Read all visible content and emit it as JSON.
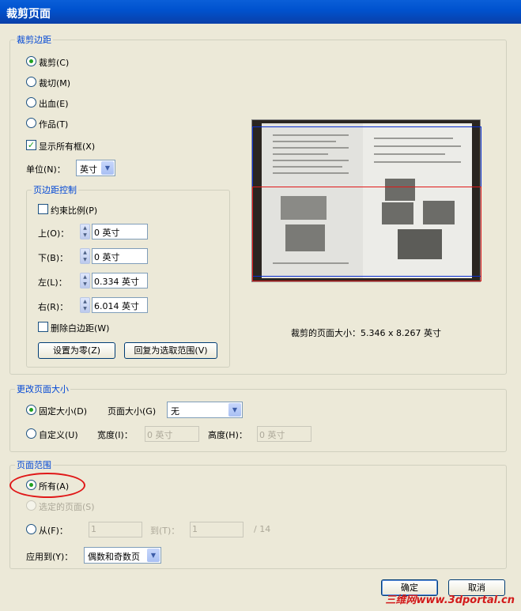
{
  "window": {
    "title": "裁剪页面"
  },
  "crop_margins": {
    "legend": "裁剪边距",
    "options": [
      {
        "label": "裁剪(C)",
        "checked": true
      },
      {
        "label": "裁切(M)",
        "checked": false
      },
      {
        "label": "出血(E)",
        "checked": false
      },
      {
        "label": "作品(T)",
        "checked": false
      }
    ],
    "show_all_boxes": {
      "label": "显示所有框(X)",
      "checked": true
    },
    "unit": {
      "label": "单位(N)：",
      "value": "英寸"
    },
    "margin_controls": {
      "legend": "页边距控制",
      "constrain": {
        "label": "约束比例(P)",
        "checked": false
      },
      "fields": [
        {
          "label": "上(O)：",
          "value": "0 英寸"
        },
        {
          "label": "下(B)：",
          "value": "0 英寸"
        },
        {
          "label": "左(L)：",
          "value": "0.334 英寸"
        },
        {
          "label": "右(R)：",
          "value": "6.014 英寸"
        }
      ],
      "remove_white": {
        "label": "删除白边距(W)",
        "checked": false
      },
      "set_zero_label": "设置为零(Z)",
      "revert_label": "回复为选取范围(V)"
    },
    "cropped_size_text": "裁剪的页面大小：5.346 x 8.267 英寸"
  },
  "change_page_size": {
    "legend": "更改页面大小",
    "fixed_size": {
      "label": "固定大小(D)",
      "checked": true
    },
    "page_size": {
      "label": "页面大小(G)",
      "value": "无"
    },
    "custom": {
      "label": "自定义(U)",
      "checked": false
    },
    "width": {
      "label": "宽度(I)：",
      "value": "0 英寸"
    },
    "height": {
      "label": "高度(H)：",
      "value": "0 英寸"
    }
  },
  "page_range": {
    "legend": "页面范围",
    "all": {
      "label": "所有(A)",
      "checked": true
    },
    "selected": {
      "label": "选定的页面(S)",
      "enabled": false
    },
    "from": {
      "label": "从(F)：",
      "value": "1"
    },
    "to": {
      "label": "到(T)：",
      "value": "1"
    },
    "total": "/ 14",
    "apply_to": {
      "label": "应用到(Y)：",
      "value": "偶数和奇数页"
    }
  },
  "buttons": {
    "ok": "确定",
    "cancel": "取消"
  },
  "watermark": "三维网www.3dportal.cn",
  "colors": {
    "title_bar": "#0a5fd8",
    "legend_text": "#0046d5",
    "crop_box": "#0a2fd0",
    "bleed_box": "#e01818",
    "annotation": "#e01818"
  }
}
